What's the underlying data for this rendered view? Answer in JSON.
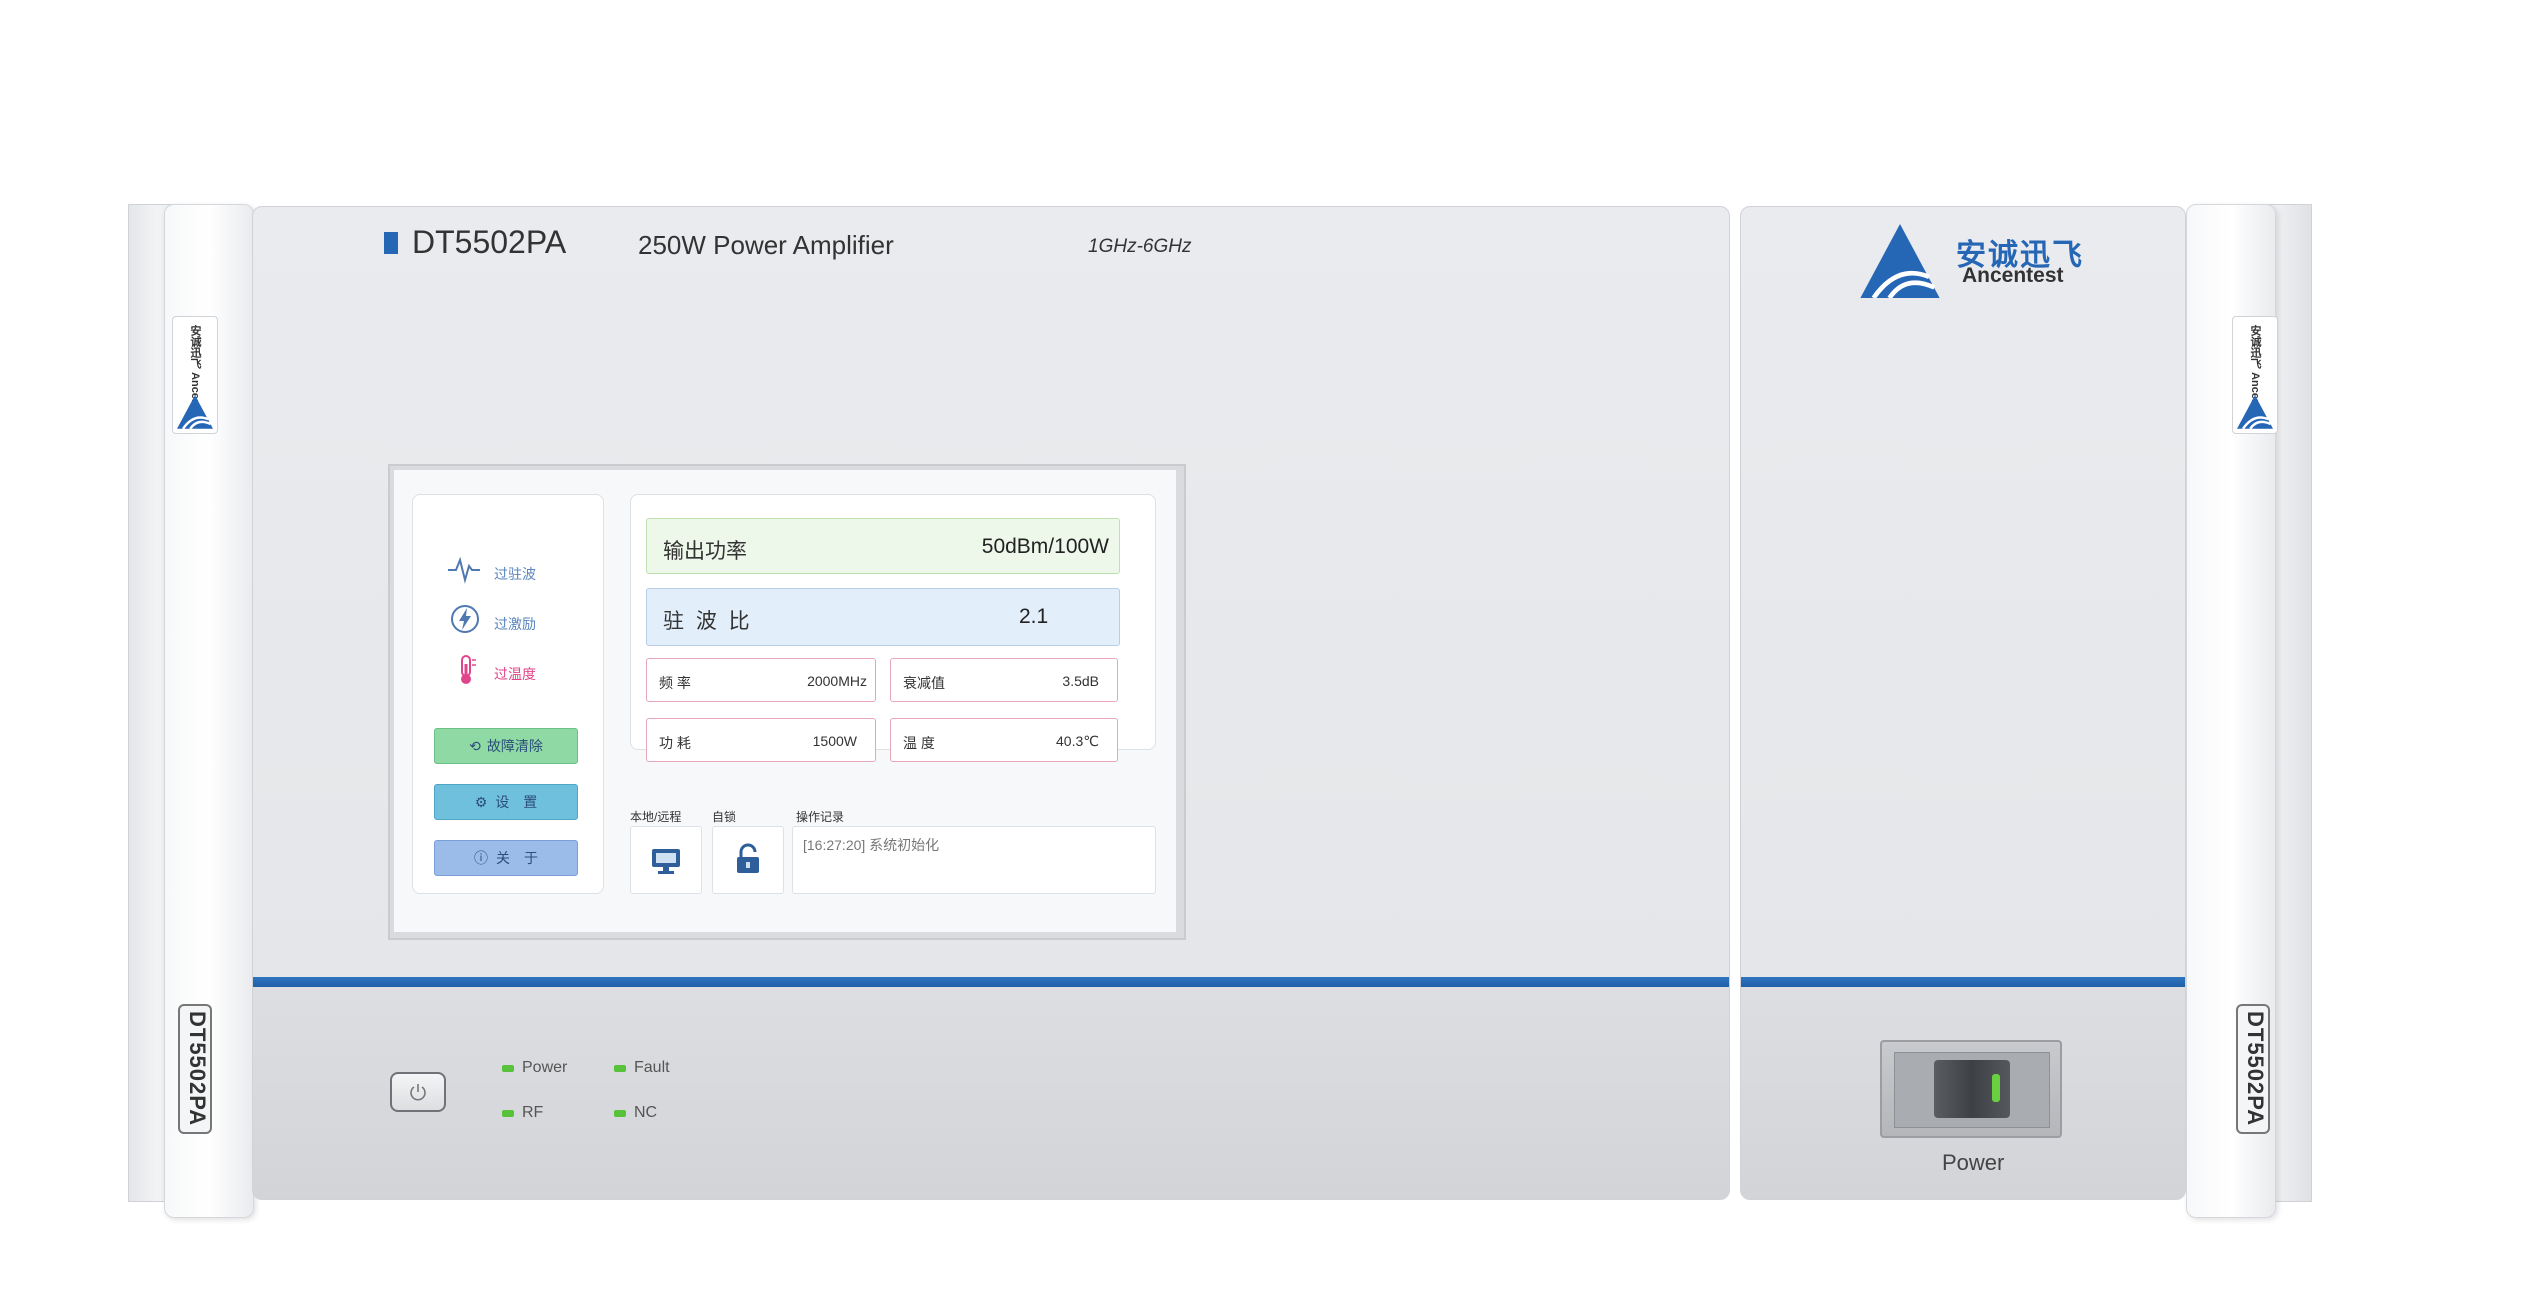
{
  "front_panel": {
    "model": "DT5502PA",
    "description": "250W Power Amplifier",
    "frequency_range": "1GHz-6GHz",
    "accent_color": "#2566b5"
  },
  "brand": {
    "name_cn": "安诚迅飞",
    "name_en": "Ancentest",
    "logo_icon": "ancentest-logo-icon"
  },
  "side_ear": {
    "badge_cn": "安诚迅飞",
    "badge_en": "Ancentest",
    "model_label": "DT5502PA"
  },
  "screen": {
    "alarms": [
      {
        "label": "过驻波",
        "icon": "waveform-icon"
      },
      {
        "label": "过激励",
        "icon": "lightning-icon"
      },
      {
        "label": "过温度",
        "icon": "thermometer-icon"
      }
    ],
    "buttons": {
      "fault_clear": "故障清除",
      "settings": "设　置",
      "about": "关　于"
    },
    "output_power": {
      "label": "输出功率",
      "value": "50dBm/100W"
    },
    "vswr": {
      "label": "驻 波 比",
      "value": "2.1"
    },
    "params": {
      "frequency": {
        "label": "频 率",
        "value": "2000MHz"
      },
      "attenuation": {
        "label": "衰减值",
        "value": "3.5dB"
      },
      "power_consumption": {
        "label": "功 耗",
        "value": "1500W"
      },
      "temperature": {
        "label": "温 度",
        "value": "40.3℃"
      }
    },
    "bottom": {
      "local_remote_label": "本地/远程",
      "lock_label": "自锁",
      "log_label": "操作记录",
      "log_entry": "[16:27:20] 系统初始化"
    }
  },
  "indicators": {
    "power": "Power",
    "fault": "Fault",
    "rf": "RF",
    "nc": "NC",
    "led_color": "#57c23a"
  },
  "power_switch_label": "Power"
}
